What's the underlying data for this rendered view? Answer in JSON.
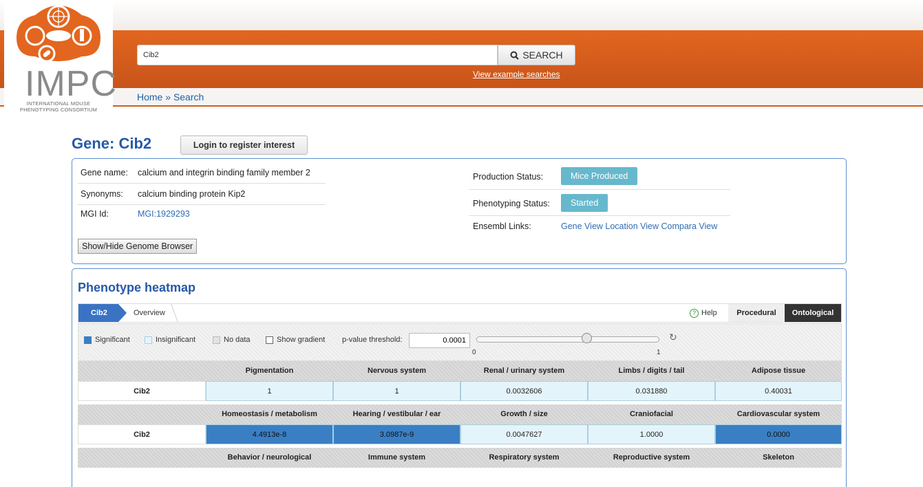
{
  "logo": {
    "text": "IMPC",
    "subtitle": "INTERNATIONAL MOUSE PHENOTYPING CONSORTIUM"
  },
  "search": {
    "value": "Cib2",
    "button_label": "SEARCH",
    "example_link": "View example searches"
  },
  "breadcrumb": {
    "home": "Home",
    "separator": "»",
    "current": "Search"
  },
  "gene": {
    "title": "Gene: Cib2",
    "login_button": "Login to register interest",
    "name_label": "Gene name:",
    "name_value": "calcium and integrin binding family member 2",
    "synonyms_label": "Synonyms:",
    "synonyms_value": "calcium binding protein Kip2",
    "mgi_label": "MGI Id:",
    "mgi_value": "MGI:1929293",
    "genome_browser_button": "Show/Hide Genome Browser",
    "production_label": "Production Status:",
    "production_value": "Mice Produced",
    "phenotyping_label": "Phenotyping Status:",
    "phenotyping_value": "Started",
    "ensembl_label": "Ensembl Links:",
    "ensembl_links": [
      "Gene View",
      "Location View",
      "Compara View"
    ]
  },
  "heatmap": {
    "title": "Phenotype heatmap",
    "tabs": {
      "gene": "Cib2",
      "overview": "Overview",
      "help": "Help",
      "procedural": "Procedural",
      "ontological": "Ontological"
    },
    "legend": {
      "significant": "Significant",
      "insignificant": "Insignificant",
      "no_data": "No data",
      "show_gradient": "Show gradient",
      "pvalue_label": "p-value threshold:",
      "pvalue_value": "0.0001",
      "slider_min": "0",
      "slider_max": "1"
    },
    "colors": {
      "significant": "#3a7fc4",
      "insignificant": "#e4f4fb"
    },
    "row_label": "Cib2",
    "header_rows": [
      [
        "Pigmentation",
        "Nervous system",
        "Renal / urinary system",
        "Limbs / digits / tail",
        "Adipose tissue"
      ],
      [
        "Homeostasis / metabolism",
        "Hearing / vestibular / ear",
        "Growth / size",
        "Craniofacial",
        "Cardiovascular system"
      ],
      [
        "Behavior / neurological",
        "Immune system",
        "Respiratory system",
        "Reproductive system",
        "Skeleton"
      ]
    ],
    "data_rows": [
      [
        "1",
        "1",
        "0.0032606",
        "0.031880",
        "0.40031"
      ],
      [
        "4.4913e-8",
        "3.0987e-9",
        "0.0047627",
        "1.0000",
        "0.0000"
      ]
    ],
    "data_significance": [
      [
        false,
        false,
        false,
        false,
        false
      ],
      [
        true,
        true,
        false,
        false,
        true
      ]
    ]
  }
}
